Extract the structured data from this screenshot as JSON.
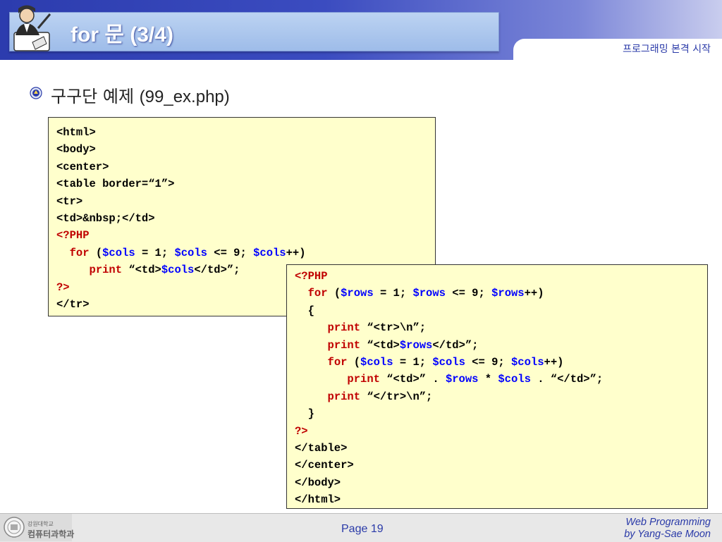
{
  "header": {
    "title": "for 문 (3/4)",
    "section": "프로그래밍 본격 시작"
  },
  "bullet": {
    "icon": "seal-bullet-icon",
    "label": "구구단 예제",
    "filename": "(99_ex.php)"
  },
  "code_box_1": [
    "<html>",
    "<body>",
    "<center>",
    "<table border=“1”>",
    "<tr>",
    "<td>&nbsp;</td>",
    "<?PHP",
    "  for ($cols = 1; $cols <= 9; $cols++)",
    "     print “<td>$cols</td>”;",
    "?>",
    "</tr>"
  ],
  "code_box_2": [
    "<?PHP",
    "  for ($rows = 1; $rows <= 9; $rows++)",
    "  {",
    "     print “<tr>\\n”;",
    "     print “<td>$rows</td>”;",
    "     for ($cols = 1; $cols <= 9; $cols++)",
    "        print “<td>” . $rows * $cols . “</td>”;",
    "     print “</tr>\\n”;",
    "  }",
    "?>",
    "</table>",
    "</center>",
    "</body>",
    "</html>"
  ],
  "footer": {
    "university": "강원대학교",
    "department": "컴퓨터과학과",
    "page": "Page 19",
    "course_line1": "Web Programming",
    "course_line2": "by Yang-Sae Moon"
  },
  "colors": {
    "keyword_red": "#c00000",
    "variable_blue": "#0000ff",
    "code_background": "#ffffcc",
    "header_blue": "#2c3cae"
  }
}
